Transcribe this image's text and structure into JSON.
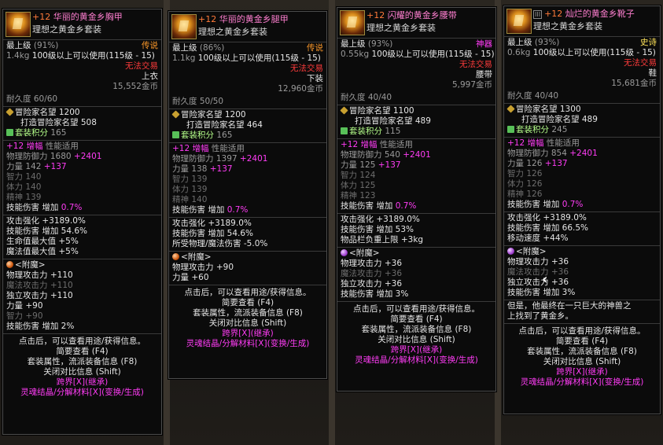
{
  "cards": [
    {
      "plus": "+12",
      "name": "华丽的黄金乡胸甲",
      "set": "理想之黄金乡套装",
      "level_label": "最上级",
      "level_pct": "(91%)",
      "rarity": "传说",
      "weight": "1.4kg",
      "req": "100级以上可以使用(115级 - 15)",
      "trade": "无法交易",
      "slot": "上衣",
      "price": "15,552金币",
      "durability": "耐久度 60/60",
      "fame_label": "冒险家名望",
      "fame": "1200",
      "craft_fame_label": "打造冒险家名望",
      "craft_fame": "508",
      "setpts_label": "套装积分",
      "setpts": "165",
      "amp_plus": "+12",
      "amp": "增幅",
      "amp_type": "性能适用",
      "stats": [
        {
          "k": "物理防御力",
          "v": "1680",
          "b": "+2401"
        },
        {
          "k": "力量",
          "v": "142",
          "b": "+137"
        },
        {
          "k": "智力",
          "v": "140",
          "b": ""
        },
        {
          "k": "体力",
          "v": "140",
          "b": ""
        },
        {
          "k": "精神",
          "v": "139",
          "b": ""
        }
      ],
      "skill_dmg": {
        "k": "技能伤害",
        "m": "增加",
        "v": "0.7%"
      },
      "extra": [
        {
          "k": "攻击强化",
          "v": "+3189.0%"
        },
        {
          "k": "技能伤害",
          "v": "增加 54.6%"
        },
        {
          "k": "生命值最大值",
          "v": "+5%"
        },
        {
          "k": "魔法值最大值",
          "v": "+5%"
        }
      ],
      "ench_label": "<附魔>",
      "ench": [
        {
          "k": "物理攻击力",
          "v": "+110",
          "c": "w"
        },
        {
          "k": "魔法攻击力",
          "v": "+110",
          "c": "dim"
        },
        {
          "k": "独立攻击力",
          "v": "+110",
          "c": "w"
        },
        {
          "k": "力量",
          "v": "+90",
          "c": "w"
        },
        {
          "k": "智力",
          "v": "+90",
          "c": "dim"
        },
        {
          "k": "技能伤害",
          "v": "增加 2%",
          "c": "w"
        }
      ],
      "footer": [
        "点击后，可以查看用途/获得信息。",
        "简要查看 (F4)",
        "套装属性，流派装备信息 (F8)",
        "关闭对比信息 (Shift)"
      ],
      "cross": "跨界[X](继承)",
      "soul": "灵魂结晶/分解材料[X](变换/生成)"
    },
    {
      "plus": "+12",
      "name": "华丽的黄金乡腿甲",
      "set": "理想之黄金乡套装",
      "level_label": "最上级",
      "level_pct": "(86%)",
      "rarity": "传说",
      "weight": "1.1kg",
      "req": "100级以上可以使用(115级 - 15)",
      "trade": "无法交易",
      "slot": "下装",
      "price": "12,960金币",
      "durability": "耐久度 50/50",
      "fame_label": "冒险家名望",
      "fame": "1200",
      "craft_fame_label": "打造冒险家名望",
      "craft_fame": "464",
      "setpts_label": "套装积分",
      "setpts": "165",
      "amp_plus": "+12",
      "amp": "增幅",
      "amp_type": "性能适用",
      "stats": [
        {
          "k": "物理防御力",
          "v": "1397",
          "b": "+2401"
        },
        {
          "k": "力量",
          "v": "138",
          "b": "+137"
        },
        {
          "k": "智力",
          "v": "139",
          "b": ""
        },
        {
          "k": "体力",
          "v": "139",
          "b": ""
        },
        {
          "k": "精神",
          "v": "140",
          "b": ""
        }
      ],
      "skill_dmg": {
        "k": "技能伤害",
        "m": "增加",
        "v": "0.7%"
      },
      "extra": [
        {
          "k": "攻击强化",
          "v": "+3189.0%"
        },
        {
          "k": "技能伤害",
          "v": "增加 54.6%"
        },
        {
          "k": "所受物理/魔法伤害",
          "v": "-5.0%"
        }
      ],
      "ench_label": "<附魔>",
      "ench": [
        {
          "k": "物理攻击力",
          "v": "+90",
          "c": "w"
        },
        {
          "k": "力量",
          "v": "+60",
          "c": "w"
        }
      ],
      "footer": [
        "点击后，可以查看用途/获得信息。",
        "简要查看 (F4)",
        "套装属性，流派装备信息 (F8)",
        "关闭对比信息 (Shift)"
      ],
      "cross": "跨界[X](继承)",
      "soul": "灵魂结晶/分解材料[X](变换/生成)"
    },
    {
      "plus": "+12",
      "name": "闪耀的黄金乡腰带",
      "set": "理想之黄金乡套装",
      "level_label": "最上级",
      "level_pct": "(93%)",
      "rarity": "神器",
      "weight": "0.55kg",
      "req": "100级以上可以使用(115级 - 15)",
      "trade": "无法交易",
      "slot": "腰带",
      "price": "5,997金币",
      "durability": "耐久度 40/40",
      "fame_label": "冒险家名望",
      "fame": "1100",
      "craft_fame_label": "打造冒险家名望",
      "craft_fame": "489",
      "setpts_label": "套装积分",
      "setpts": "115",
      "amp_plus": "+12",
      "amp": "增幅",
      "amp_type": "性能适用",
      "stats": [
        {
          "k": "物理防御力",
          "v": "540",
          "b": "+2401"
        },
        {
          "k": "力量",
          "v": "125",
          "b": "+137"
        },
        {
          "k": "智力",
          "v": "124",
          "b": ""
        },
        {
          "k": "体力",
          "v": "125",
          "b": ""
        },
        {
          "k": "精神",
          "v": "123",
          "b": ""
        }
      ],
      "skill_dmg": {
        "k": "技能伤害",
        "m": "增加",
        "v": "0.7%"
      },
      "extra": [
        {
          "k": "攻击强化",
          "v": "+3189.0%"
        },
        {
          "k": "技能伤害",
          "v": "增加 53%"
        },
        {
          "k": "物品栏负重上限",
          "v": "+3kg"
        }
      ],
      "ench_label": "<附魔>",
      "ench": [
        {
          "k": "物理攻击力",
          "v": "+36",
          "c": "w"
        },
        {
          "k": "魔法攻击力",
          "v": "+36",
          "c": "dim"
        },
        {
          "k": "独立攻击力",
          "v": "+36",
          "c": "w"
        },
        {
          "k": "技能伤害",
          "v": "增加 3%",
          "c": "w"
        }
      ],
      "footer": [
        "点击后，可以查看用途/获得信息。",
        "简要查看 (F4)",
        "套装属性，流派装备信息 (F8)",
        "关闭对比信息 (Shift)"
      ],
      "cross": "跨界[X](继承)",
      "soul": "灵魂结晶/分解材料[X](变换/生成)"
    },
    {
      "plus": "+12",
      "name": "灿烂的黄金乡靴子",
      "set": "理想之黄金乡套装",
      "level_label": "最上级",
      "level_pct": "(93%)",
      "rarity": "史诗",
      "weight": "0.6kg",
      "req": "100级以上可以使用(115级 - 15)",
      "trade": "无法交易",
      "slot": "鞋",
      "price": "15,681金币",
      "durability": "耐久度 40/40",
      "fame_label": "冒险家名望",
      "fame": "1300",
      "craft_fame_label": "打造冒险家名望",
      "craft_fame": "489",
      "setpts_label": "套装积分",
      "setpts": "245",
      "amp_plus": "+12",
      "amp": "增幅",
      "amp_type": "性能适用",
      "stats": [
        {
          "k": "物理防御力",
          "v": "854",
          "b": "+2401"
        },
        {
          "k": "力量",
          "v": "126",
          "b": "+137"
        },
        {
          "k": "智力",
          "v": "126",
          "b": ""
        },
        {
          "k": "体力",
          "v": "126",
          "b": ""
        },
        {
          "k": "精神",
          "v": "126",
          "b": ""
        }
      ],
      "skill_dmg": {
        "k": "技能伤害",
        "m": "增加",
        "v": "0.7%"
      },
      "extra": [
        {
          "k": "攻击强化",
          "v": "+3189.0%"
        },
        {
          "k": "技能伤害",
          "v": "增加 66.5%"
        },
        {
          "k": "移动速度",
          "v": "+44%"
        }
      ],
      "ench_label": "<附魔>",
      "ench": [
        {
          "k": "物理攻击力",
          "v": "+36",
          "c": "w"
        },
        {
          "k": "魔法攻击力",
          "v": "+36",
          "c": "dim"
        },
        {
          "k": "独立攻击力",
          "v": "+36",
          "c": "w"
        },
        {
          "k": "技能伤害",
          "v": "增加 3%",
          "c": "w"
        }
      ],
      "flavor": [
        "但是，他最终在一只巨大的神兽之",
        "上找到了黄金乡。"
      ],
      "footer": [
        "点击后，可以查看用途/获得信息。",
        "简要查看 (F4)",
        "套装属性，流派装备信息 (F8)",
        "关闭对比信息 (Shift)"
      ],
      "cross": "跨界[X](继承)",
      "soul": "灵魂结晶/分解材料[X](变换/生成)",
      "tier_tag": "III"
    }
  ],
  "colors": {
    "rarity_legend": "#ff7a3a",
    "rarity_myth": "#ff3cf5",
    "rarity_epic": "#ffe35a",
    "amp": "#ff3cf5",
    "bonus": "#ff3cf5"
  }
}
